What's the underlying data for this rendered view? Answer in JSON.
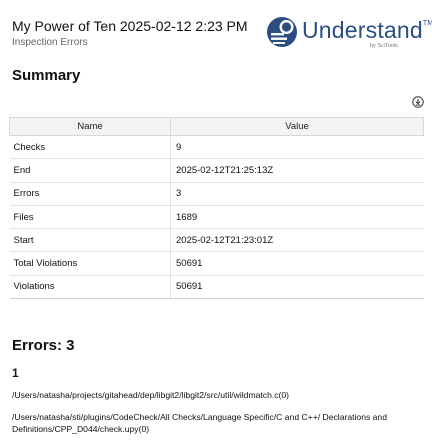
{
  "header": {
    "title": "My Power of Ten 2025-02-12 2:23 PM",
    "subtitle": "Inspection Errors"
  },
  "logo": {
    "word": "Understand",
    "tm": "TM",
    "by": "by SciTools",
    "brand_color": "#2b4e82"
  },
  "summary": {
    "heading": "Summary",
    "download_icon": "download-circle-icon",
    "columns": [
      "Name",
      "Value"
    ],
    "rows": [
      {
        "name": "Checks",
        "value": "9"
      },
      {
        "name": "End",
        "value": "2025-02-12T21:25:13Z"
      },
      {
        "name": "Errors",
        "value": "3"
      },
      {
        "name": "Files",
        "value": "1689"
      },
      {
        "name": "Start",
        "value": "2025-02-12T21:23:01Z"
      },
      {
        "name": "Total Violations",
        "value": "50691"
      },
      {
        "name": "Violations",
        "value": "50691"
      }
    ]
  },
  "errors": {
    "heading": "Errors: 3",
    "items": [
      {
        "number": "1",
        "paths": [
          "/Users/natasha/projects/gitahead/dep/libgit2/libgit2/src/util/wildmatch.c(0)",
          "/Users/natasha/sti/plugins/CodeCheck/All Checks/Language Specific/C and C++/ Declarations and Definitions/CPP_D044/check.upy(0)"
        ]
      }
    ]
  }
}
